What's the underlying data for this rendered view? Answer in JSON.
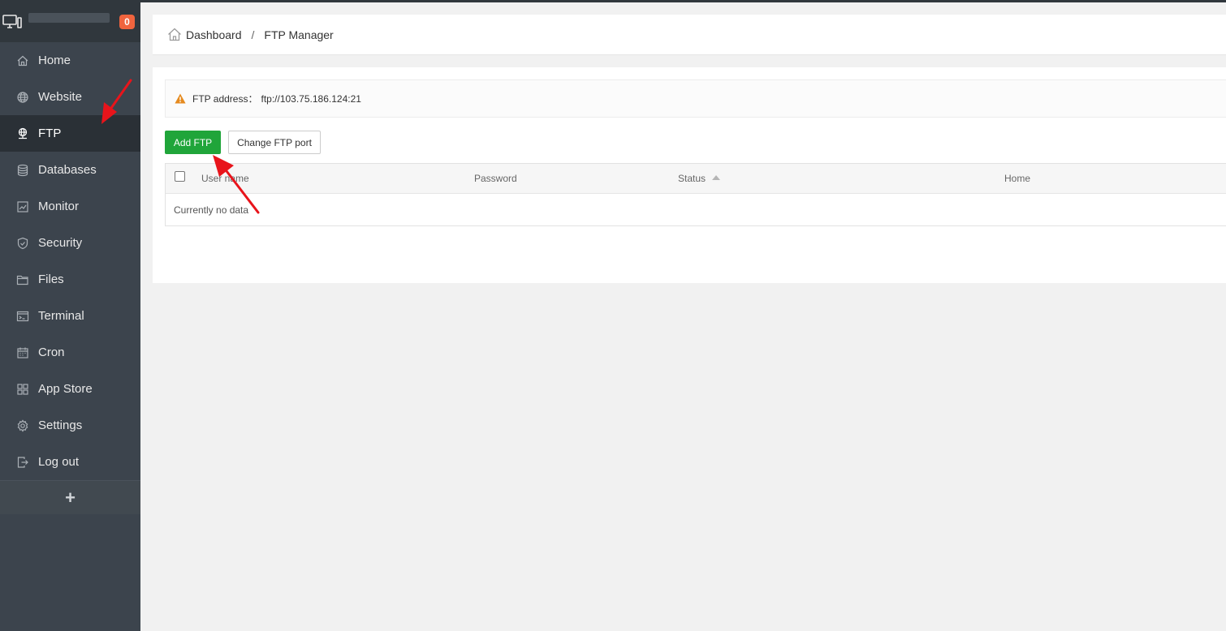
{
  "sidebar": {
    "badge": "0",
    "items": [
      {
        "label": "Home",
        "icon": "home-icon"
      },
      {
        "label": "Website",
        "icon": "globe-icon"
      },
      {
        "label": "FTP",
        "icon": "ftp-icon",
        "active": true
      },
      {
        "label": "Databases",
        "icon": "database-icon"
      },
      {
        "label": "Monitor",
        "icon": "monitor-chart-icon"
      },
      {
        "label": "Security",
        "icon": "shield-icon"
      },
      {
        "label": "Files",
        "icon": "folder-icon"
      },
      {
        "label": "Terminal",
        "icon": "terminal-icon"
      },
      {
        "label": "Cron",
        "icon": "calendar-icon"
      },
      {
        "label": "App Store",
        "icon": "grid-icon"
      },
      {
        "label": "Settings",
        "icon": "gear-icon"
      },
      {
        "label": "Log out",
        "icon": "logout-icon"
      }
    ],
    "add_label": "+"
  },
  "breadcrumb": {
    "home": "Dashboard",
    "separator": "/",
    "current": "FTP Manager"
  },
  "alert": {
    "label": "FTP address：",
    "address": "ftp://103.75.186.124:21"
  },
  "toolbar": {
    "add_ftp": "Add FTP",
    "change_port": "Change FTP port"
  },
  "table": {
    "columns": [
      "User name",
      "Password",
      "Status",
      "Home"
    ],
    "empty": "Currently no data"
  },
  "colors": {
    "sidebar_bg": "#3c444d",
    "sidebar_active": "#2a3036",
    "accent_green": "#20a53a",
    "badge": "#f0643e",
    "annotation_arrow": "#e8141b"
  }
}
